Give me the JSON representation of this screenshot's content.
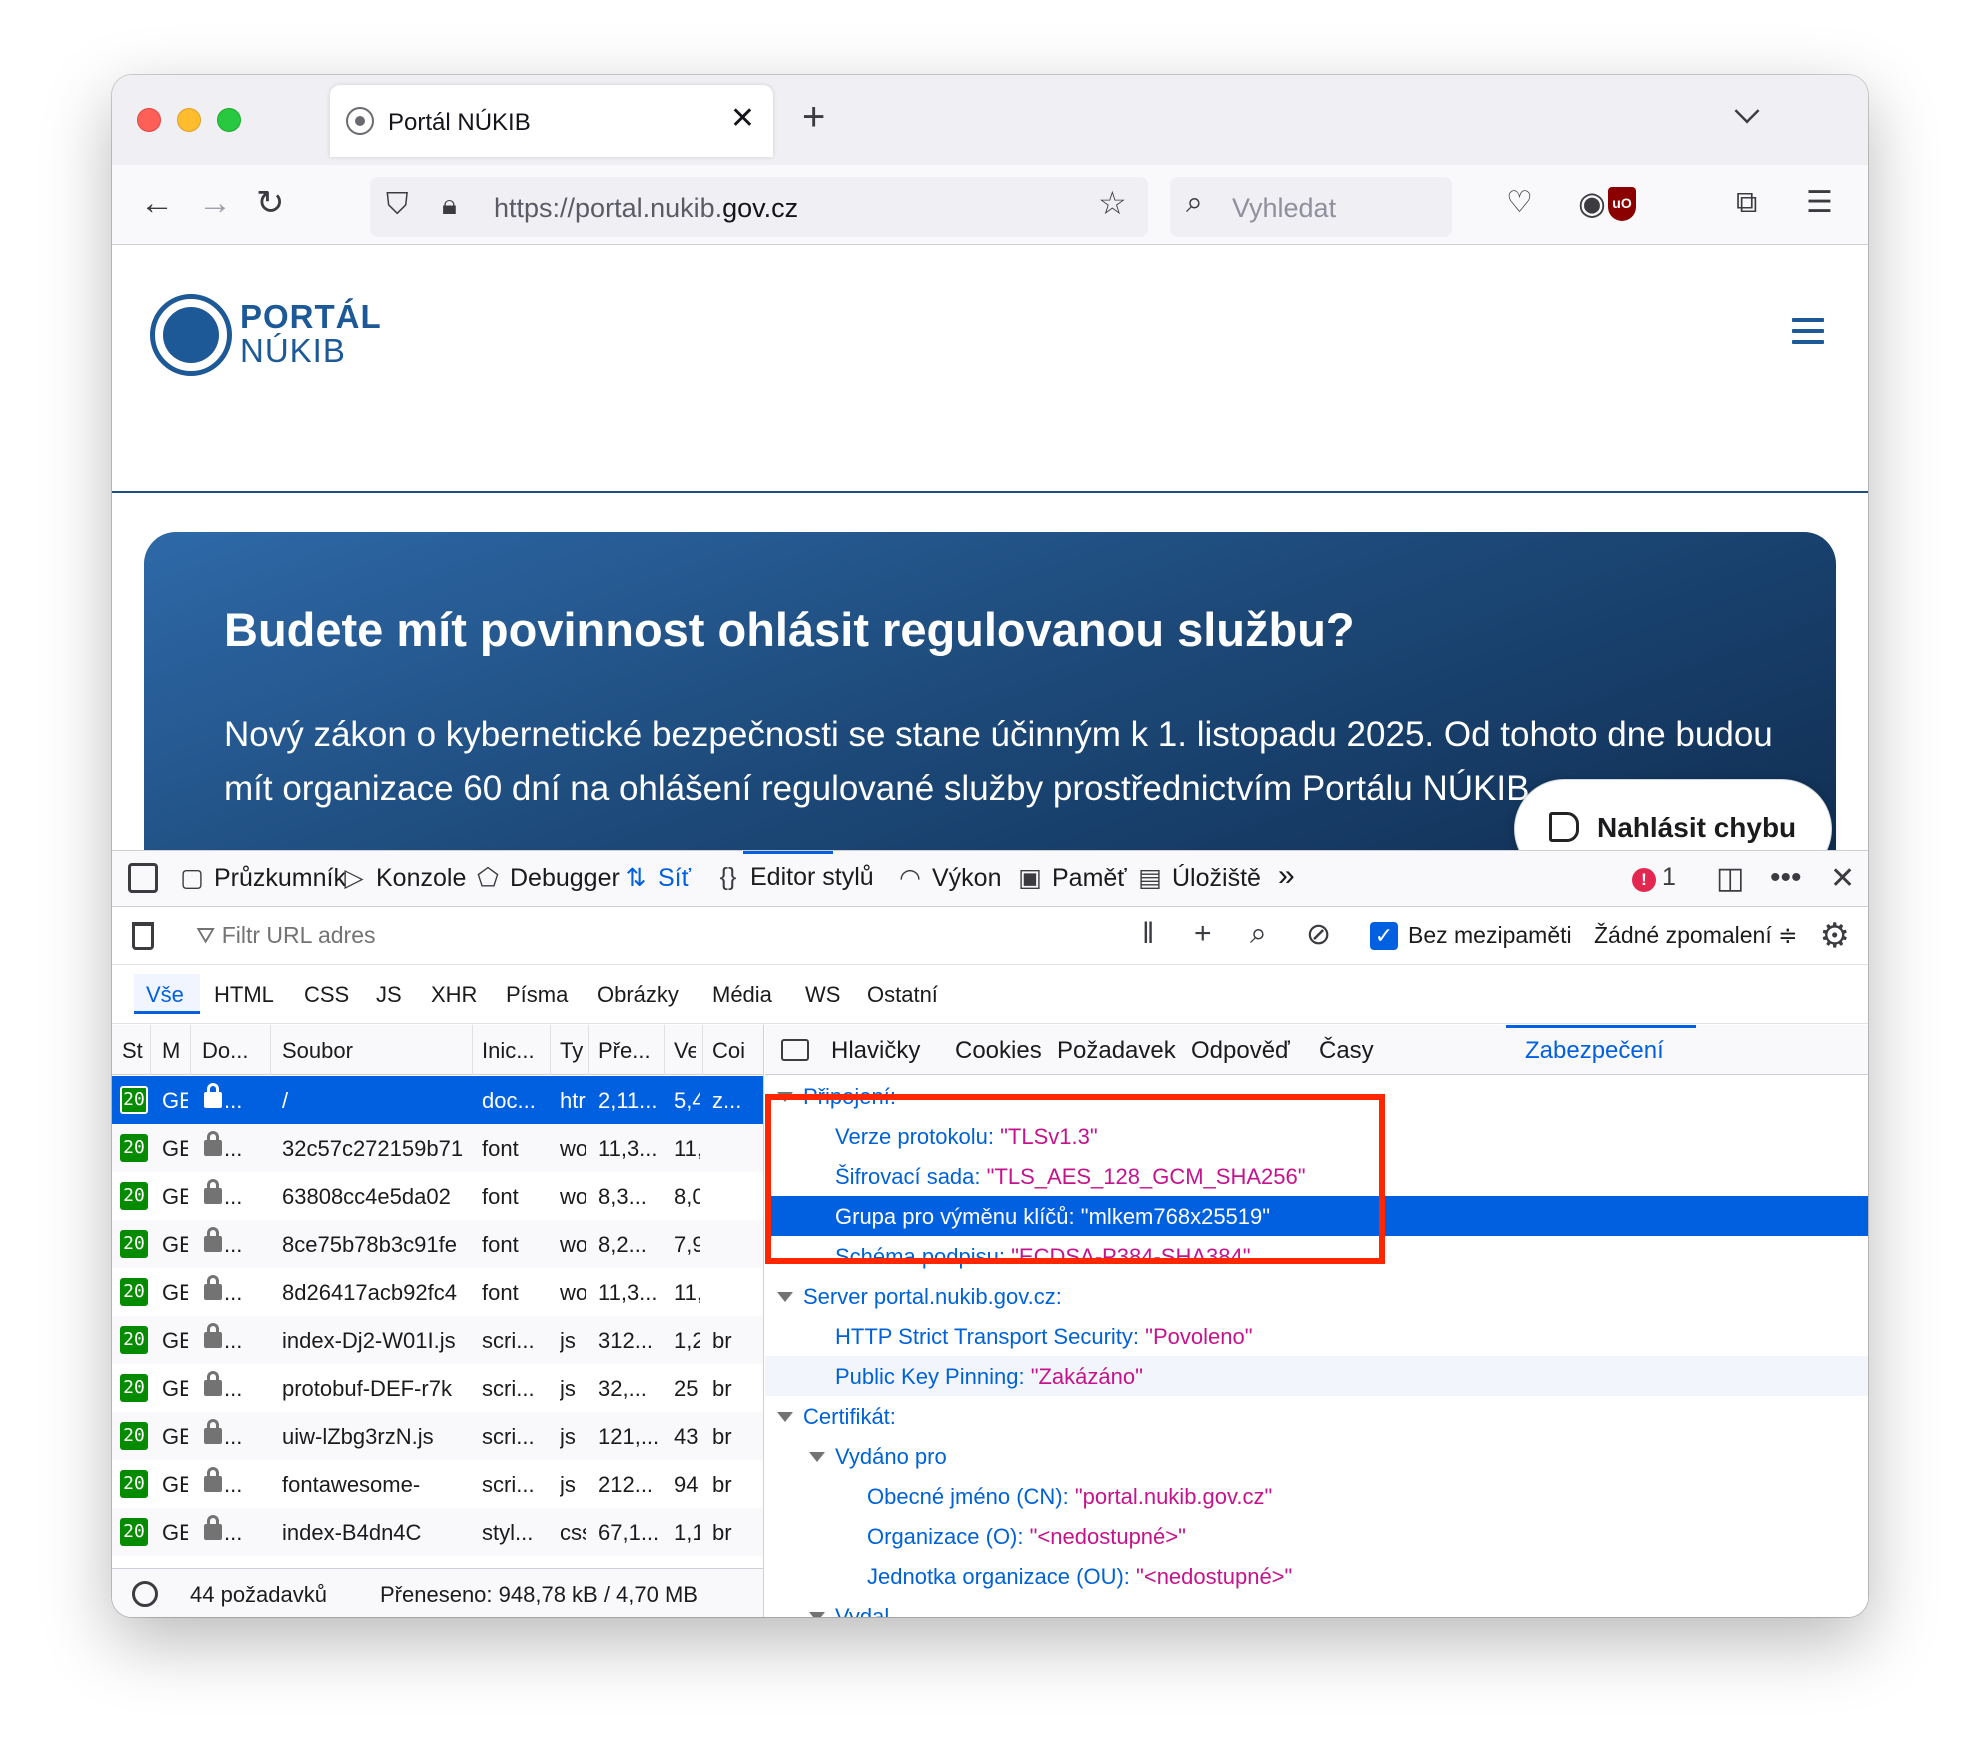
{
  "browser": {
    "tab_title": "Portál NÚKIB",
    "url_prefix": "https://portal.nukib.",
    "url_domain": "gov.cz",
    "search_placeholder": "Vyhledat"
  },
  "site": {
    "logo_line1": "PORTÁL",
    "logo_line2": "NÚKIB",
    "hero_title": "Budete mít povinnost ohlásit regulovanou službu?",
    "hero_text": "Nový zákon o kybernetické bezpečnosti se stane účinným k 1. listopadu 2025. Od tohoto dne budou mít organizace 60 dní na ohlášení regulované služby prostřednictvím Portálu NÚKIB",
    "report_button": "Nahlásit chybu"
  },
  "devtools": {
    "tabs": {
      "inspector": "Průzkumník",
      "console": "Konzole",
      "debugger": "Debugger",
      "network": "Síť",
      "style_editor": "Editor stylů",
      "performance": "Výkon",
      "memory": "Paměť",
      "storage": "Úložiště"
    },
    "error_count": "1",
    "filter_placeholder": "Filtr URL adres",
    "no_cache_label": "Bez mezipaměti",
    "throttling": "Žádné zpomalení ≑",
    "type_filters": [
      "Vše",
      "HTML",
      "CSS",
      "JS",
      "XHR",
      "Písma",
      "Obrázky",
      "Média",
      "WS",
      "Ostatní"
    ],
    "columns": [
      "St",
      "M",
      "Do...",
      "Soubor",
      "Inic...",
      "Ty",
      "Pře...",
      "Ve",
      "Coi"
    ],
    "requests": [
      {
        "status": "20",
        "method": "GE",
        "domain": "...",
        "file": "/",
        "initiator": "doc...",
        "type": "htr",
        "transferred": "2,11...",
        "size": "5,4",
        "enc": "z..."
      },
      {
        "status": "20",
        "method": "GE",
        "domain": "...",
        "file": "32c57c272159b71",
        "initiator": "font",
        "type": "wo",
        "transferred": "11,3...",
        "size": "11,",
        "enc": ""
      },
      {
        "status": "20",
        "method": "GE",
        "domain": "...",
        "file": "63808cc4e5da02",
        "initiator": "font",
        "type": "wo",
        "transferred": "8,3...",
        "size": "8,0",
        "enc": ""
      },
      {
        "status": "20",
        "method": "GE",
        "domain": "...",
        "file": "8ce75b78b3c91fe",
        "initiator": "font",
        "type": "wo",
        "transferred": "8,2...",
        "size": "7,9",
        "enc": ""
      },
      {
        "status": "20",
        "method": "GE",
        "domain": "...",
        "file": "8d26417acb92fc4",
        "initiator": "font",
        "type": "wo",
        "transferred": "11,3...",
        "size": "11,",
        "enc": ""
      },
      {
        "status": "20",
        "method": "GE",
        "domain": "...",
        "file": "index-Dj2-W01I.js",
        "initiator": "scri...",
        "type": "js",
        "transferred": "312...",
        "size": "1,2",
        "enc": "br"
      },
      {
        "status": "20",
        "method": "GE",
        "domain": "...",
        "file": "protobuf-DEF-r7k",
        "initiator": "scri...",
        "type": "js",
        "transferred": "32,...",
        "size": "25",
        "enc": "br"
      },
      {
        "status": "20",
        "method": "GE",
        "domain": "...",
        "file": "uiw-lZbg3rzN.js",
        "initiator": "scri...",
        "type": "js",
        "transferred": "121,...",
        "size": "43",
        "enc": "br"
      },
      {
        "status": "20",
        "method": "GE",
        "domain": "...",
        "file": "fontawesome-",
        "initiator": "scri...",
        "type": "js",
        "transferred": "212...",
        "size": "94",
        "enc": "br"
      },
      {
        "status": "20",
        "method": "GE",
        "domain": "...",
        "file": "index-B4dn4C",
        "initiator": "styl...",
        "type": "css",
        "transferred": "67,1...",
        "size": "1,1",
        "enc": "br"
      }
    ],
    "footer": {
      "requests": "44 požadavků",
      "transferred": "Přeneseno: 948,78 kB / 4,70 MB"
    },
    "detail_tabs": [
      "Hlavičky",
      "Cookies",
      "Požadavek",
      "Odpověď",
      "Časy",
      "Zabezpečení"
    ],
    "security": {
      "connection_heading": "Připojení:",
      "protocol_key": "Verze protokolu:",
      "protocol_val": "\"TLSv1.3\"",
      "cipher_key": "Šifrovací sada:",
      "cipher_val": "\"TLS_AES_128_GCM_SHA256\"",
      "kex_key": "Grupa pro výměnu klíčů:",
      "kex_val": "\"mlkem768x25519\"",
      "sig_key": "Schéma podpisu:",
      "sig_val": "\"ECDSA-P384-SHA384\"",
      "server_heading": "Server portal.nukib.gov.cz:",
      "hsts_key": "HTTP Strict Transport Security:",
      "hsts_val": "\"Povoleno\"",
      "pinning_key": "Public Key Pinning:",
      "pinning_val": "\"Zakázáno\"",
      "cert_heading": "Certifikát:",
      "issued_to_heading": "Vydáno pro",
      "cn_key": "Obecné jméno (CN):",
      "cn_val": "\"portal.nukib.gov.cz\"",
      "o_key": "Organizace (O):",
      "o_val": "\"<nedostupné>\"",
      "ou_key": "Jednotka organizace (OU):",
      "ou_val": "\"<nedostupné>\"",
      "issued_by_heading": "Vydal"
    }
  }
}
